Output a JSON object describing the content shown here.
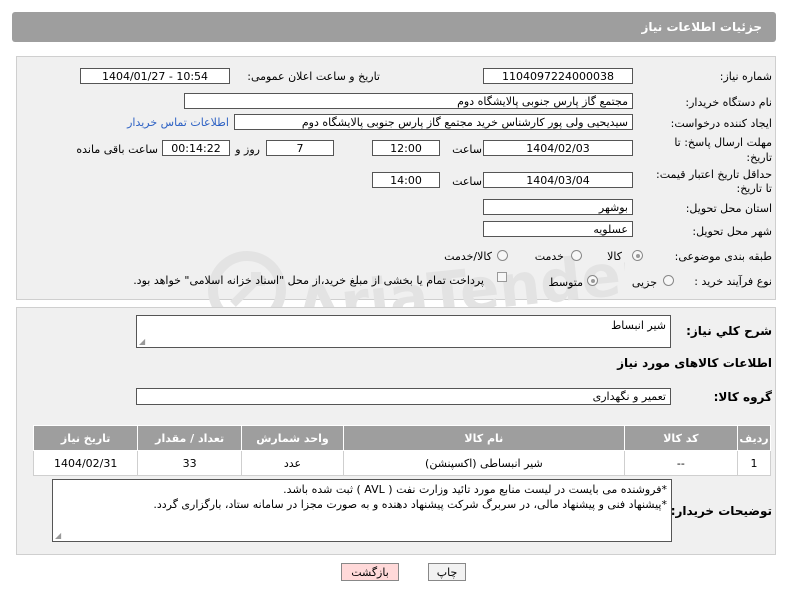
{
  "header": {
    "title": "جزئیات اطلاعات نیاز"
  },
  "fields": {
    "need_number_label": "شماره نیاز:",
    "need_number": "1104097224000038",
    "announce_label": "تاریخ و ساعت اعلان عمومی:",
    "announce_value": "1404/01/27 - 10:54",
    "buyer_org_label": "نام دستگاه خریدار:",
    "buyer_org": "مجتمع گاز پارس جنوبی  پالایشگاه دوم",
    "requester_label": "ایجاد کننده درخواست:",
    "requester": "سیدیحیی ولی پور کارشناس خرید مجتمع گاز پارس جنوبی  پالایشگاه دوم",
    "contact_link": "اطلاعات تماس خریدار",
    "deadline_label_1": "مهلت ارسال پاسخ: تا",
    "deadline_label_2": "تاریخ:",
    "deadline_date": "1404/02/03",
    "time_label": "ساعت",
    "deadline_time": "12:00",
    "days_value": "7",
    "days_label": "روز و",
    "remaining_time": "00:14:22",
    "remaining_label": "ساعت باقی مانده",
    "validity_label_1": "حداقل تاریخ اعتبار قیمت:",
    "validity_label_2": "تا تاریخ:",
    "validity_date": "1404/03/04",
    "validity_time": "14:00",
    "province_label": "استان محل تحویل:",
    "province": "بوشهر",
    "city_label": "شهر محل تحویل:",
    "city": "عسلویه",
    "category_label": "طبقه بندی موضوعی:",
    "category_options": [
      "کالا",
      "خدمت",
      "کالا/خدمت"
    ],
    "process_label": "نوع فرآیند خرید :",
    "process_options": [
      "جزیی",
      "متوسط"
    ],
    "payment_note": "پرداخت تمام یا بخشی از مبلغ خرید،از محل \"اسناد خزانه اسلامی\" خواهد بود."
  },
  "description": {
    "label": "شرح كلي نياز:",
    "value": "شیر انبساط"
  },
  "goods": {
    "section_title": "اطلاعات کالاهای مورد نیاز",
    "group_label": "گروه کالا:",
    "group_value": "تعمیر و نگهداری",
    "columns": [
      "ردیف",
      "کد کالا",
      "نام کالا",
      "واحد شمارش",
      "تعداد / مقدار",
      "تاریخ نیاز"
    ],
    "rows": [
      [
        "1",
        "--",
        "شیر انبساطی (اکسپنشن)",
        "عدد",
        "33",
        "1404/02/31"
      ]
    ]
  },
  "buyer_notes": {
    "label": "توضیحات خریدار:",
    "line1": "*فروشنده می بایست در لیست منابع مورد تائید وزارت نفت ( AVL ) ثبت شده باشد.",
    "line2": "*پیشنهاد فنی و پیشنهاد مالی، در سربرگ شرکت پیشنهاد دهنده و به صورت مجزا در سامانه ستاد، بارگزاری گردد."
  },
  "buttons": {
    "print": "چاپ",
    "back": "بازگشت"
  }
}
